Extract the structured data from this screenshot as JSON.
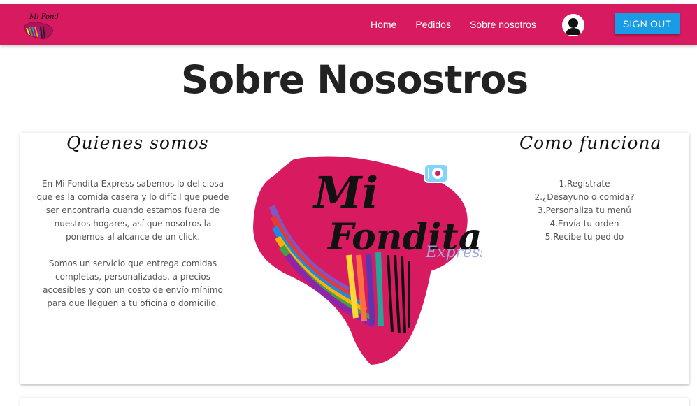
{
  "navbar": {
    "logo_text": "Mi Fondita",
    "links": [
      "Home",
      "Pedidos",
      "Sobre nosotros"
    ],
    "signout_label": "SIGN OUT"
  },
  "page": {
    "title": "Sobre Nosostros"
  },
  "about": {
    "left_heading": "Quienes somos",
    "paragraphs": [
      "En Mi Fondita Express sabemos lo deliciosa que es la comida casera y lo difícil que puede ser encontrarla cuando estamos fuera de nuestros hogares, así que nosotros la ponemos al alcance de un click.",
      "Somos un servicio que entrega comidas completas, personalizadas, a precios accesibles y con un costo de envío mínimo para que lleguen a tu oficina o domicilio."
    ],
    "logo": {
      "line1": "Mi",
      "line2": "Fondita",
      "line3": "Express"
    },
    "right_heading": "Como funciona",
    "steps": [
      "1.Regístrate",
      "2.¿Desayuno o comida?",
      "3.Personaliza tu menú",
      "4.Envía tu orden",
      "5.Recibe tu pedido"
    ]
  },
  "colors": {
    "brand": "#d81b60",
    "button": "#1a9be6"
  }
}
